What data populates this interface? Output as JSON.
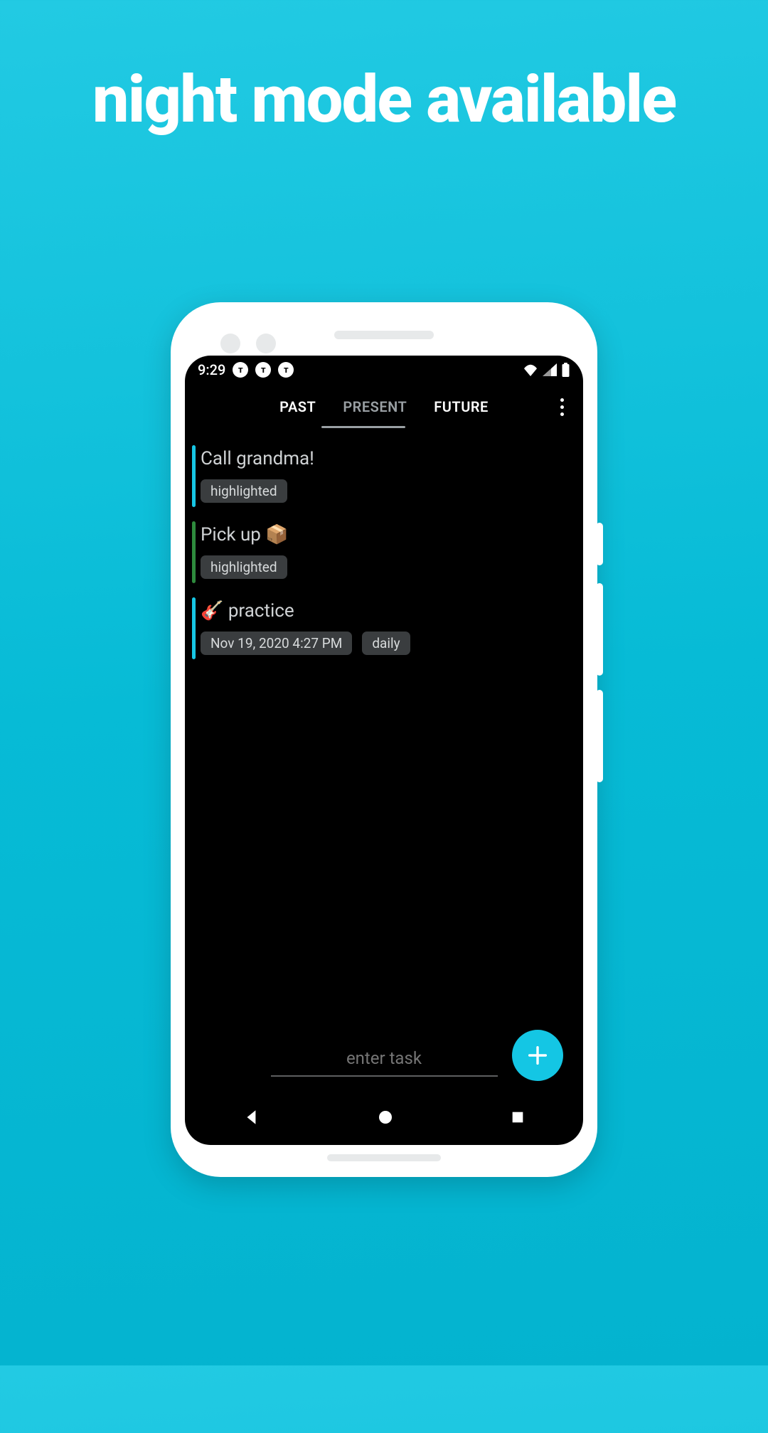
{
  "headline": "night mode available",
  "status": {
    "time": "9:29",
    "dot_glyph": "т"
  },
  "tabs": {
    "items": [
      {
        "label": "PAST",
        "active": false
      },
      {
        "label": "PRESENT",
        "active": true
      },
      {
        "label": "FUTURE",
        "active": false
      }
    ]
  },
  "tasks": [
    {
      "title": "Call grandma!",
      "stripe": "#17c6e4",
      "chips": [
        "highlighted"
      ]
    },
    {
      "title": "Pick up 📦",
      "stripe": "#2e8b3d",
      "chips": [
        "highlighted"
      ]
    },
    {
      "title": "🎸  practice",
      "stripe": "#17c6e4",
      "chips": [
        "Nov 19, 2020 4:27 PM",
        "daily"
      ]
    }
  ],
  "input": {
    "placeholder": "enter task"
  },
  "colors": {
    "accent": "#14c6e4"
  }
}
